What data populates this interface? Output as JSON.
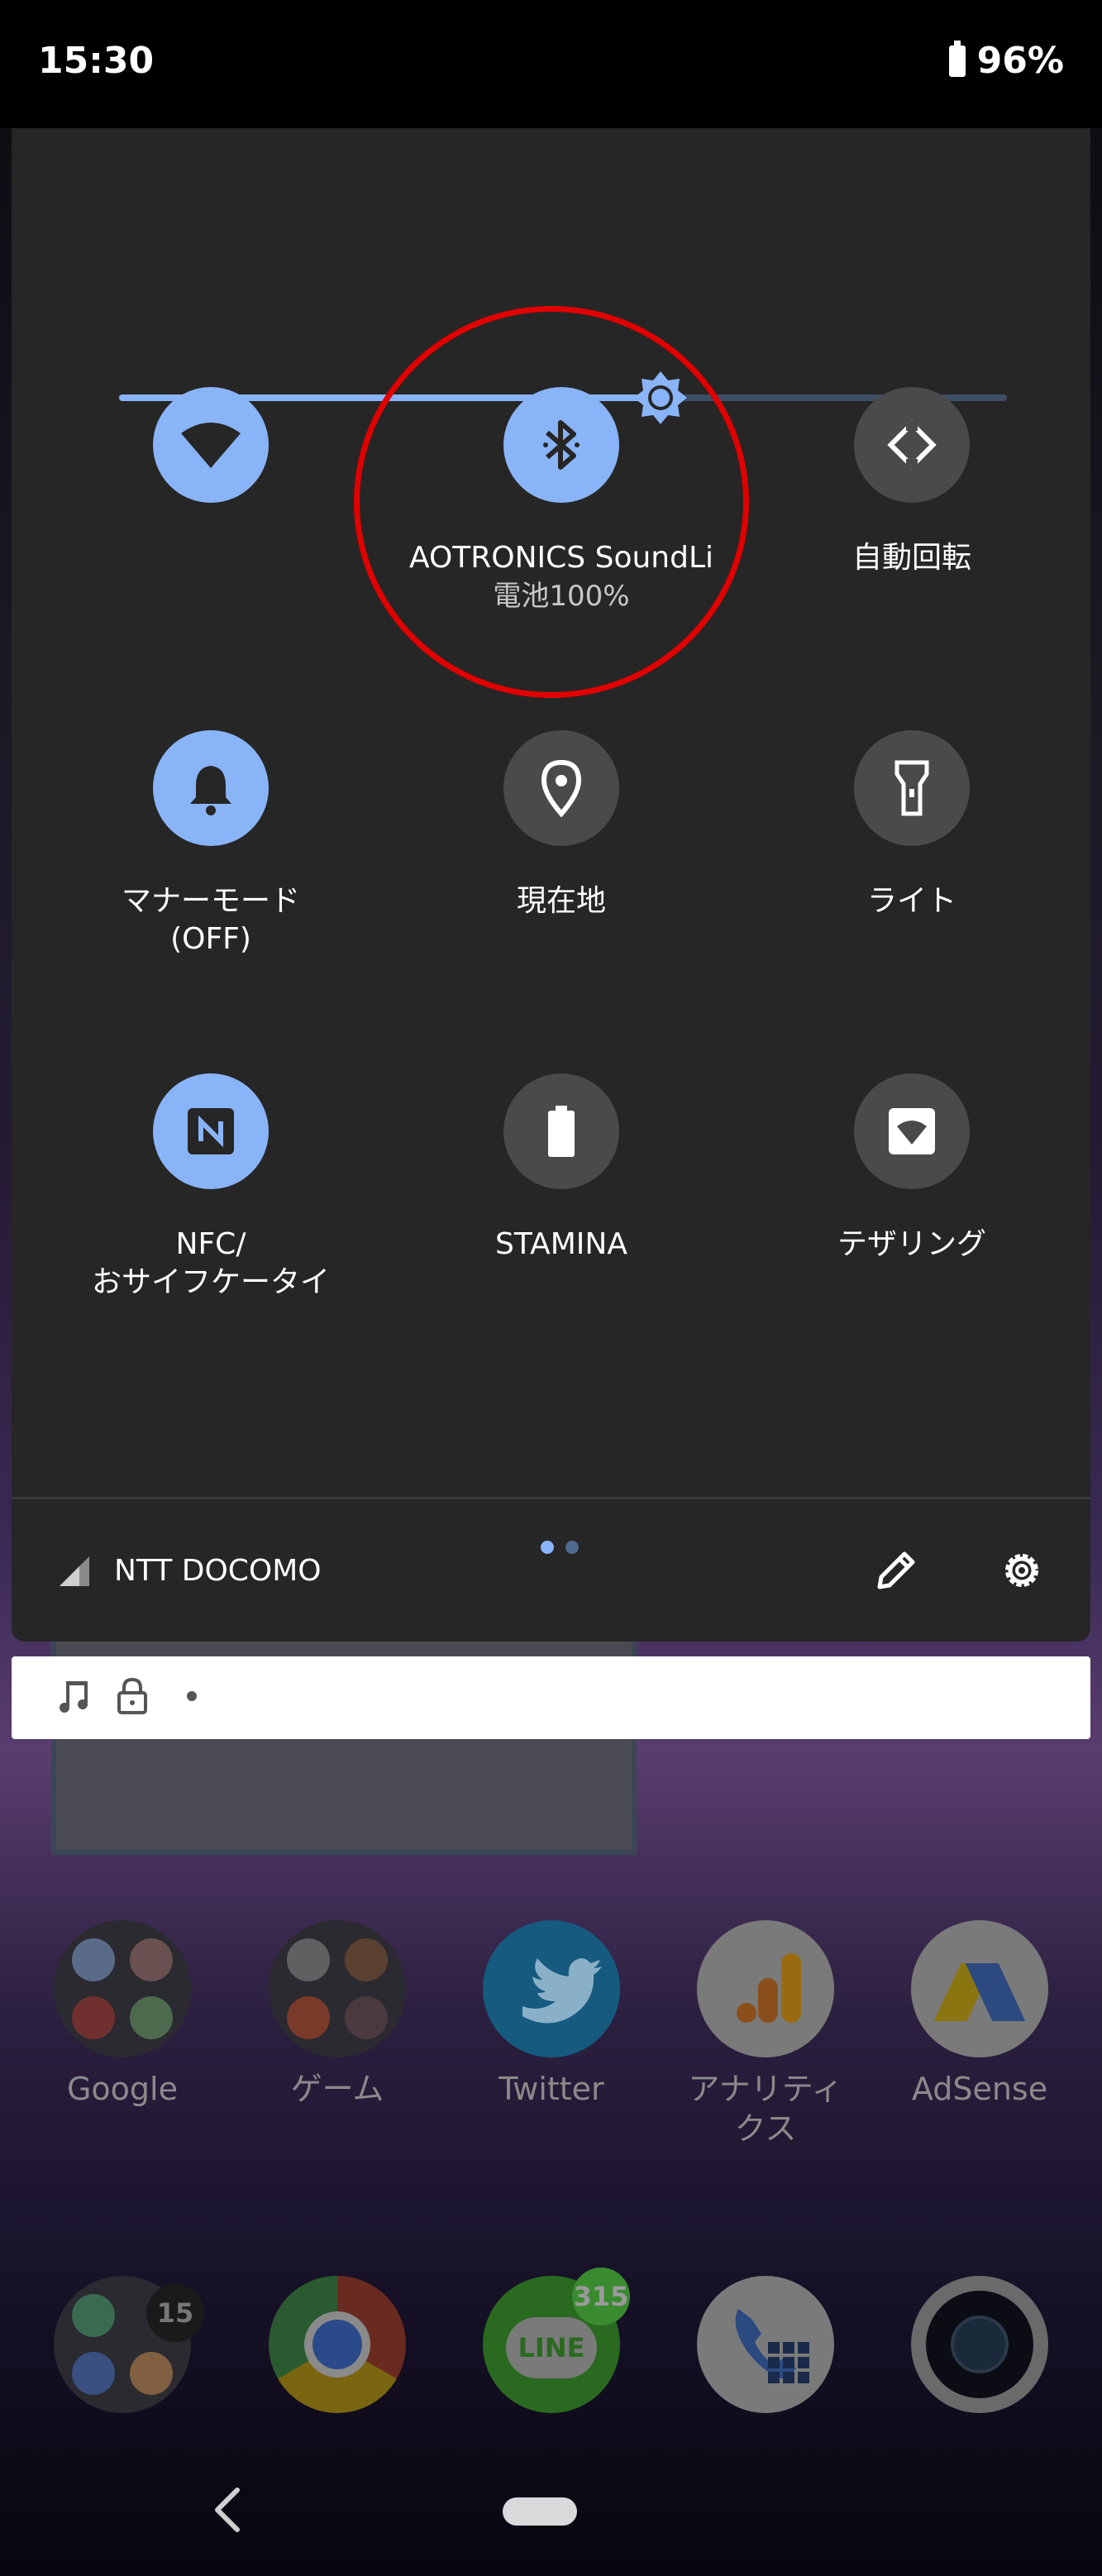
{
  "status_bar": {
    "time": "15:30",
    "battery_percent": "96%"
  },
  "brightness": {
    "level": 0.61,
    "accent": "#8ab4f8"
  },
  "tiles": [
    {
      "label": "",
      "sub": "",
      "icon": "wifi-icon",
      "state": "on"
    },
    {
      "label": "AOTRONICS SoundLi",
      "sub": "電池100%",
      "icon": "bluetooth-icon",
      "state": "on"
    },
    {
      "label": "自動回転",
      "sub": "",
      "icon": "auto-rotate-icon",
      "state": "off"
    },
    {
      "label": "マナーモード\n(OFF)",
      "sub": "",
      "icon": "bell-icon",
      "state": "on"
    },
    {
      "label": "現在地",
      "sub": "",
      "icon": "location-pin-icon",
      "state": "off"
    },
    {
      "label": "ライト",
      "sub": "",
      "icon": "flashlight-icon",
      "state": "off"
    },
    {
      "label": "NFC/\nおサイフケータイ",
      "sub": "",
      "icon": "nfc-icon",
      "state": "on"
    },
    {
      "label": "STAMINA",
      "sub": "",
      "icon": "battery-stamina-icon",
      "state": "off"
    },
    {
      "label": "テザリング",
      "sub": "",
      "icon": "hotspot-icon",
      "state": "off"
    }
  ],
  "page_indicator": {
    "pages": 2,
    "current": 1
  },
  "footer": {
    "carrier": "NTT DOCOMO"
  },
  "apps_row1": [
    {
      "name": "Google"
    },
    {
      "name": "ゲーム"
    },
    {
      "name": "Twitter"
    },
    {
      "name": "アナリティ\nクス"
    },
    {
      "name": "AdSense"
    }
  ],
  "dock_badges": {
    "folder": "15",
    "line": "315"
  },
  "dock_labels": {
    "line": "LINE"
  },
  "colors": {
    "panel": "#262626",
    "tile_on": "#8ab4f8",
    "tile_off": "#4a4a4a",
    "highlight_ring": "#e00000"
  }
}
